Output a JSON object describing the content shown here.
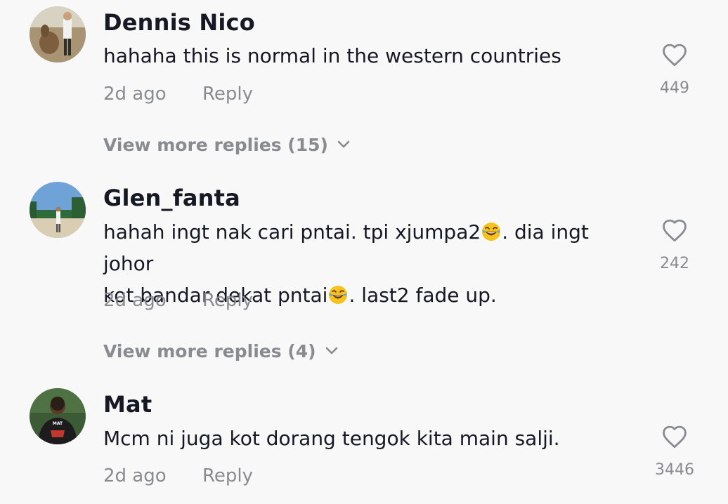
{
  "comments": [
    {
      "username": "Dennis Nico",
      "text": "hahaha this is normal in the western countries",
      "time": "2d ago",
      "reply_label": "Reply",
      "likes": "449",
      "view_more": "View more replies (15)"
    },
    {
      "username": "Glen_fanta",
      "text_line1_a": "hahah ingt nak cari pntai. tpi xjumpa2",
      "text_line1_b": ". dia ingt johor",
      "text_line2_a": "kot bandar dekat pntai",
      "text_line2_b": ". last2 fade up.",
      "time": "2d ago",
      "reply_label": "Reply",
      "likes": "242",
      "view_more": "View more replies (4)"
    },
    {
      "username": "Mat",
      "text": "Mcm ni juga kot dorang tengok kita main salji.",
      "time": "2d ago",
      "reply_label": "Reply",
      "likes": "3446",
      "avatar_text": "MAT"
    }
  ],
  "icons": {
    "like": "heart-outline-icon",
    "expand": "chevron-down-icon",
    "emoji": "face-with-tears-of-joy-emoji"
  },
  "colors": {
    "background": "#f8f8f8",
    "primary_text": "#161823",
    "secondary_text": "#8a8b91"
  }
}
